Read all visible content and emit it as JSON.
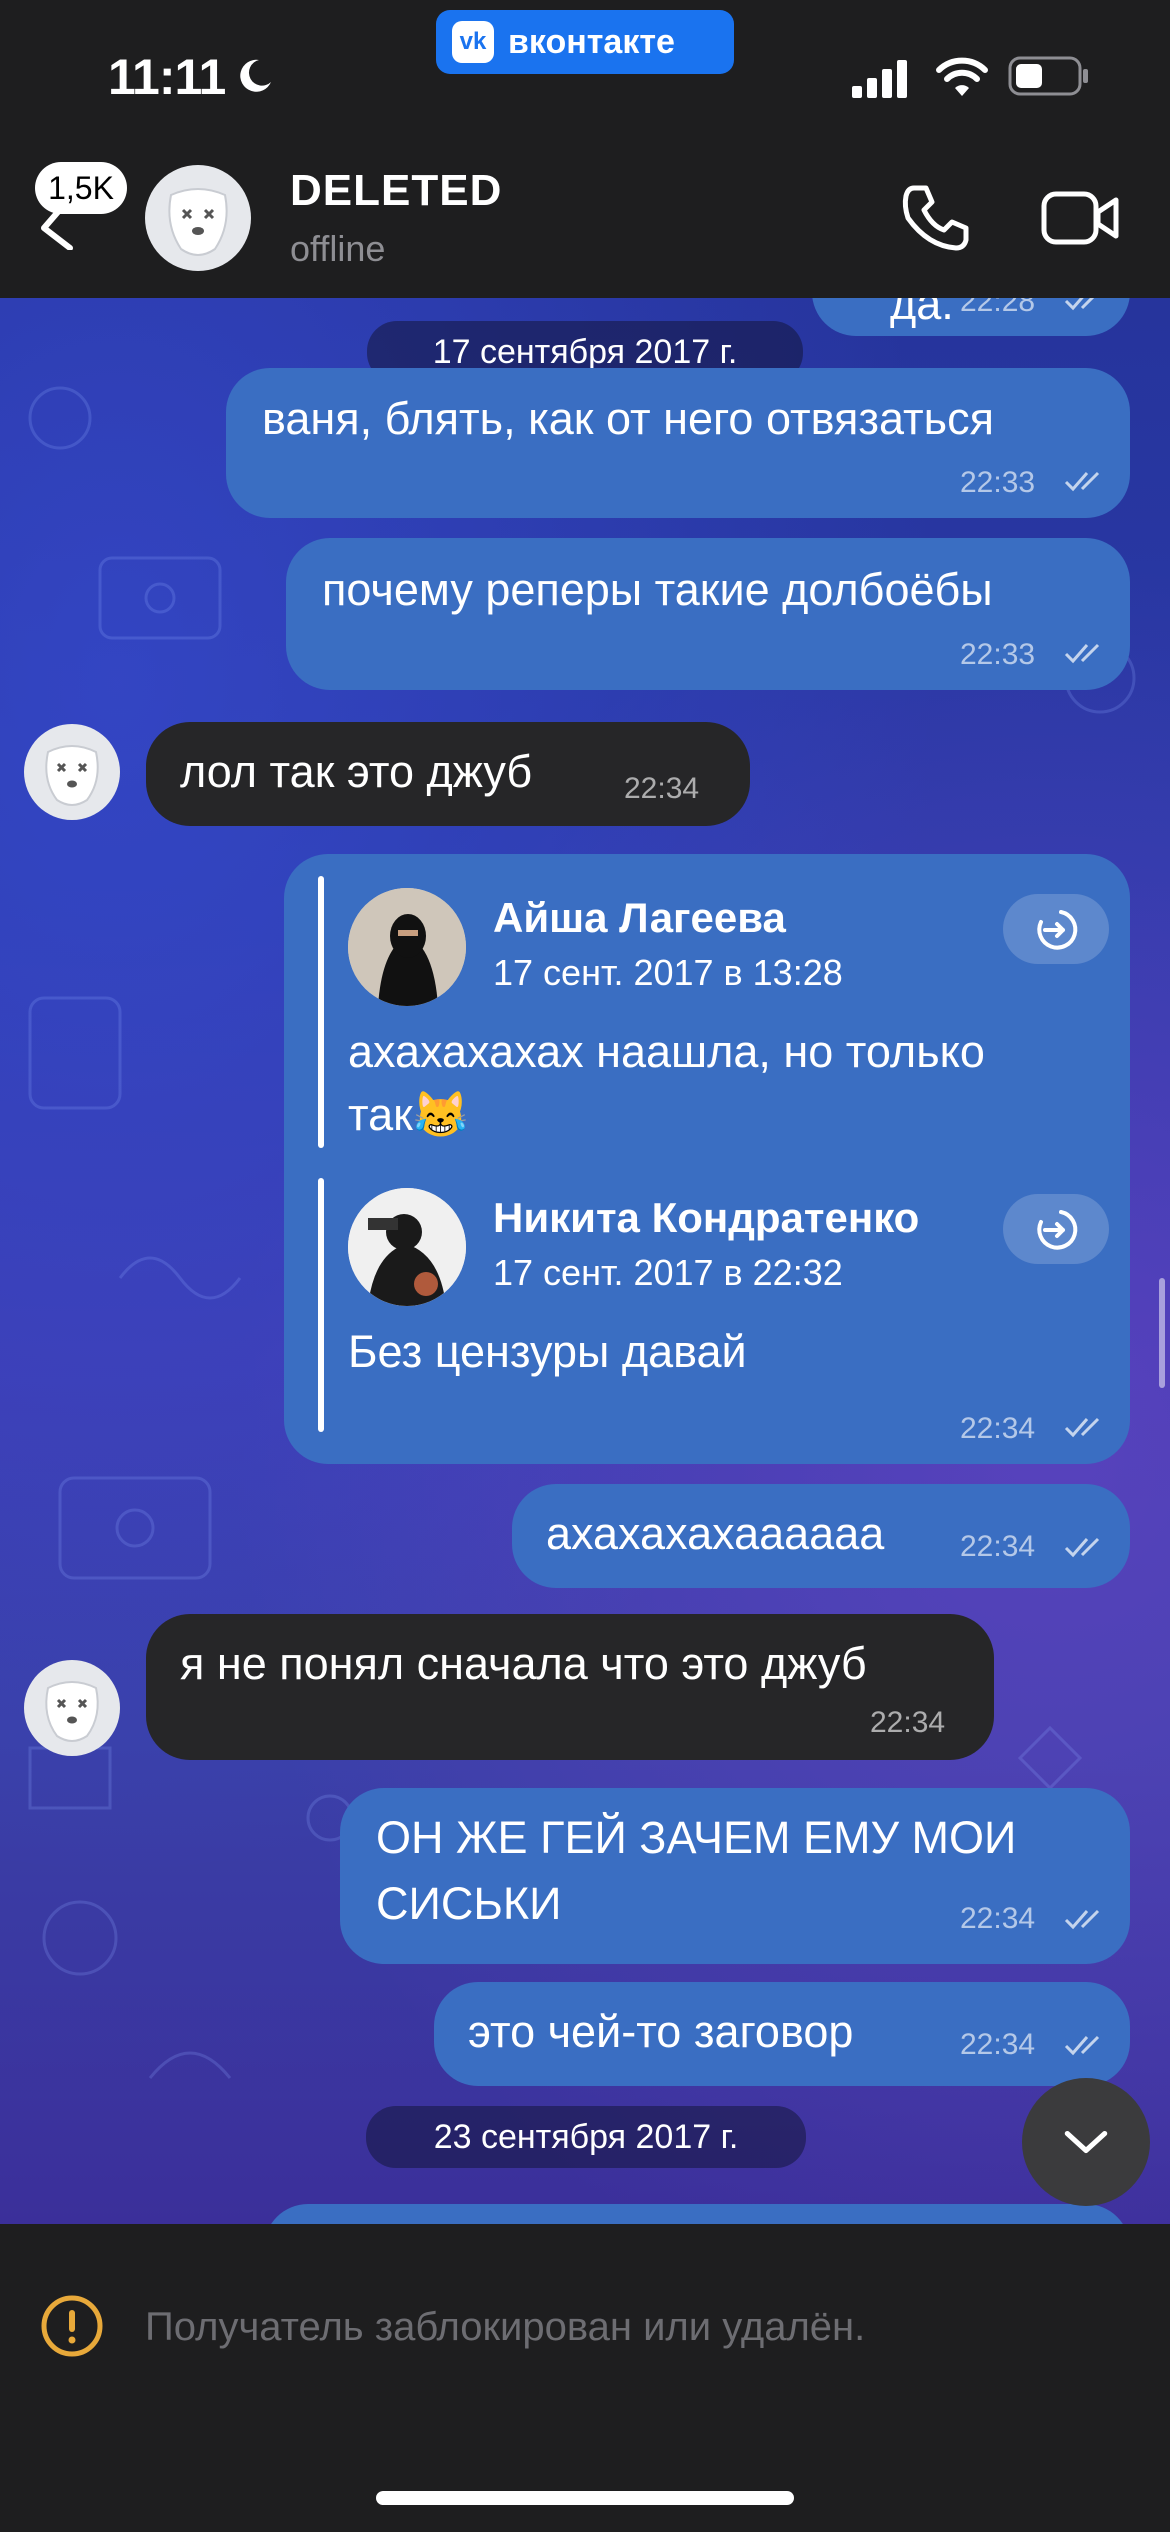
{
  "status_bar": {
    "time": "11:11",
    "vk_label": "вконтакте",
    "vk_logo": "vk"
  },
  "header": {
    "back_badge": "1,5K",
    "title": "DELETED",
    "subtitle": "offline"
  },
  "top_partial": {
    "text": "да.",
    "time": "22:28"
  },
  "dates": {
    "d1": "17 сентября 2017 г.",
    "d2": "23 сентября 2017 г."
  },
  "messages": [
    {
      "text": "ваня, блять, как от него отвязаться",
      "time": "22:33"
    },
    {
      "text": "почему реперы такие долбоёбы",
      "time": "22:33"
    },
    {
      "text": "лол так это джуб",
      "time": "22:34"
    },
    {
      "time": "22:34"
    },
    {
      "text": "ахахахахаааааа",
      "time": "22:34"
    },
    {
      "text": "я не понял сначала что это джуб",
      "time": "22:34"
    },
    {
      "text_line1": "ОН ЖЕ ГЕЙ ЗАЧЕМ ЕМУ МОИ",
      "text_line2": "СИСЬКИ",
      "time": "22:34"
    },
    {
      "text": "это чей-то заговор",
      "time": "22:34"
    }
  ],
  "forwarded": [
    {
      "name": "Айша Лагеева",
      "date": "17 сент. 2017 в 13:28",
      "text_line1": "ахахахахах наашла, но только",
      "text_line2": "так😹"
    },
    {
      "name": "Никита Кондратенко",
      "date": "17 сент. 2017 в 22:32",
      "text": "Без цензуры давай"
    }
  ],
  "footer": {
    "blocked": "Получатель заблокирован или удалён."
  },
  "colors": {
    "outgoing": "#3a6ec2",
    "incoming": "#262628",
    "vk_blue": "#1a73ef",
    "bar": "#1e1e1f",
    "warning": "#e8a93a"
  }
}
